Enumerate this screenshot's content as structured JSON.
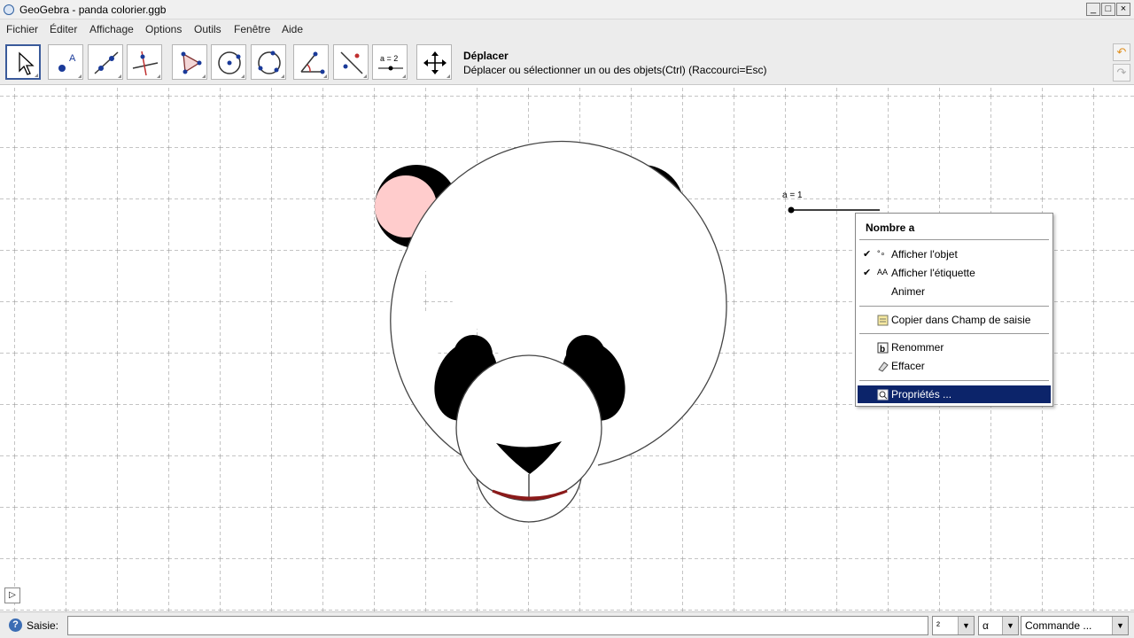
{
  "window": {
    "title": "GeoGebra - panda colorier.ggb",
    "controls": [
      "_",
      "□",
      "×"
    ]
  },
  "menu": [
    "Fichier",
    "Éditer",
    "Affichage",
    "Options",
    "Outils",
    "Fenêtre",
    "Aide"
  ],
  "toolbar": {
    "tools": [
      {
        "icon": "move-pointer-icon"
      },
      {
        "icon": "point-icon"
      },
      {
        "icon": "line-through-two-points-icon"
      },
      {
        "icon": "perpendicular-line-icon"
      },
      {
        "icon": "polygon-icon"
      },
      {
        "icon": "circle-center-point-icon"
      },
      {
        "icon": "circle-three-points-icon"
      },
      {
        "icon": "angle-icon"
      },
      {
        "icon": "reflect-about-line-icon"
      },
      {
        "icon": "slider-icon",
        "label": "a = 2"
      },
      {
        "icon": "move-graphics-view-icon"
      }
    ],
    "active_tool_name": "Déplacer",
    "active_tool_help": "Déplacer ou sélectionner un ou des objets(Ctrl) (Raccourci=Esc)"
  },
  "graphics": {
    "slider_label": "a = 1"
  },
  "context_menu": {
    "title": "Nombre a",
    "items": [
      {
        "label": "Afficher l'objet",
        "checked": true,
        "icon": "show-object-icon"
      },
      {
        "label": "Afficher l'étiquette",
        "checked": true,
        "icon": "show-label-icon"
      },
      {
        "label": "Animer",
        "checked": false
      },
      {
        "label": "Copier dans Champ de saisie",
        "icon": "copy-to-input-icon"
      },
      {
        "label": "Renommer",
        "icon": "rename-icon"
      },
      {
        "label": "Effacer",
        "icon": "eraser-icon"
      },
      {
        "label": "Propriétés ...",
        "icon": "properties-icon",
        "highlighted": true
      }
    ]
  },
  "statusbar": {
    "input_label": "Saisie:",
    "input_value": "",
    "superscript_combo": "²",
    "greek_combo": "α",
    "command_combo": "Commande ..."
  },
  "colors": {
    "highlight": "#0c246a",
    "ear_inner": "#ffcccc",
    "mouth": "#8b1a1a"
  }
}
